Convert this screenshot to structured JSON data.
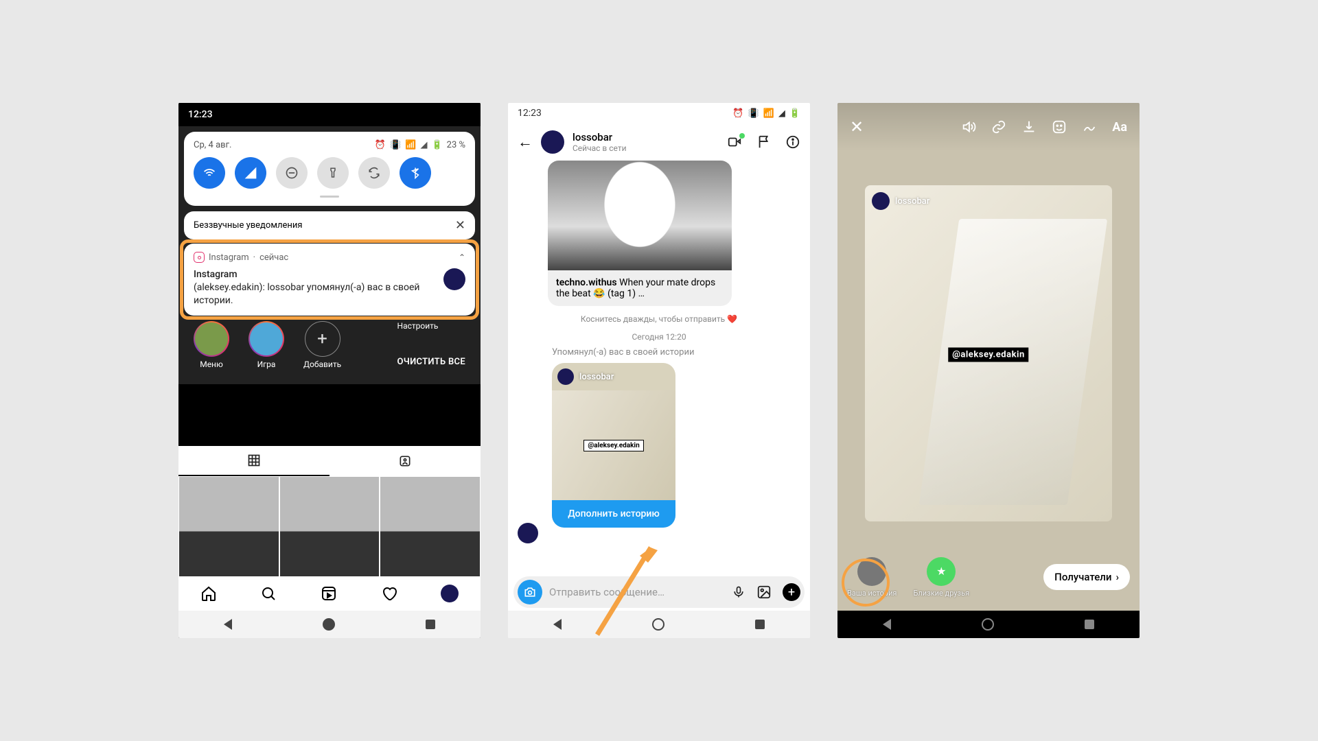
{
  "phone1": {
    "status_time": "12:23",
    "qs": {
      "date": "Ср, 4 авг.",
      "battery": "23 %"
    },
    "silent_header": "Беззвучные уведомления",
    "notification": {
      "app": "Instagram",
      "time_suffix": "сейчас",
      "separator": "·",
      "title": "Instagram",
      "body": "(aleksey.edakin): lossobar упомянул(-а) вас в своей истории."
    },
    "shade_actions": {
      "settings": "Настроить",
      "clear": "ОЧИСТИТЬ ВСЕ"
    },
    "highlights": {
      "menu": "Меню",
      "game": "Игра",
      "add": "Добавить",
      "plus": "+"
    }
  },
  "phone2": {
    "status_time": "12:23",
    "header": {
      "name": "lossobar",
      "status": "Сейчас в сети"
    },
    "post": {
      "user": "techno.withus",
      "caption": "When your mate drops the beat 😂 (tag 1) …"
    },
    "hint": "Коснитесь дважды, чтобы отправить ❤️",
    "timestamp": "Сегодня 12:20",
    "mention_label": "Упомянул(-а) вас в своей истории",
    "story_preview": {
      "name": "lossobar",
      "tag": "@aleksey.edakin"
    },
    "add_story_button": "Дополнить историю",
    "composer_placeholder": "Отправить сообщение…"
  },
  "phone3": {
    "editor_text_tool": "Aa",
    "card": {
      "name": "lossobar",
      "tag": "@aleksey.edakin"
    },
    "share": {
      "your_story": "Ваша история",
      "close_friends": "Близкие друзья"
    },
    "recipients_button": "Получатели"
  }
}
